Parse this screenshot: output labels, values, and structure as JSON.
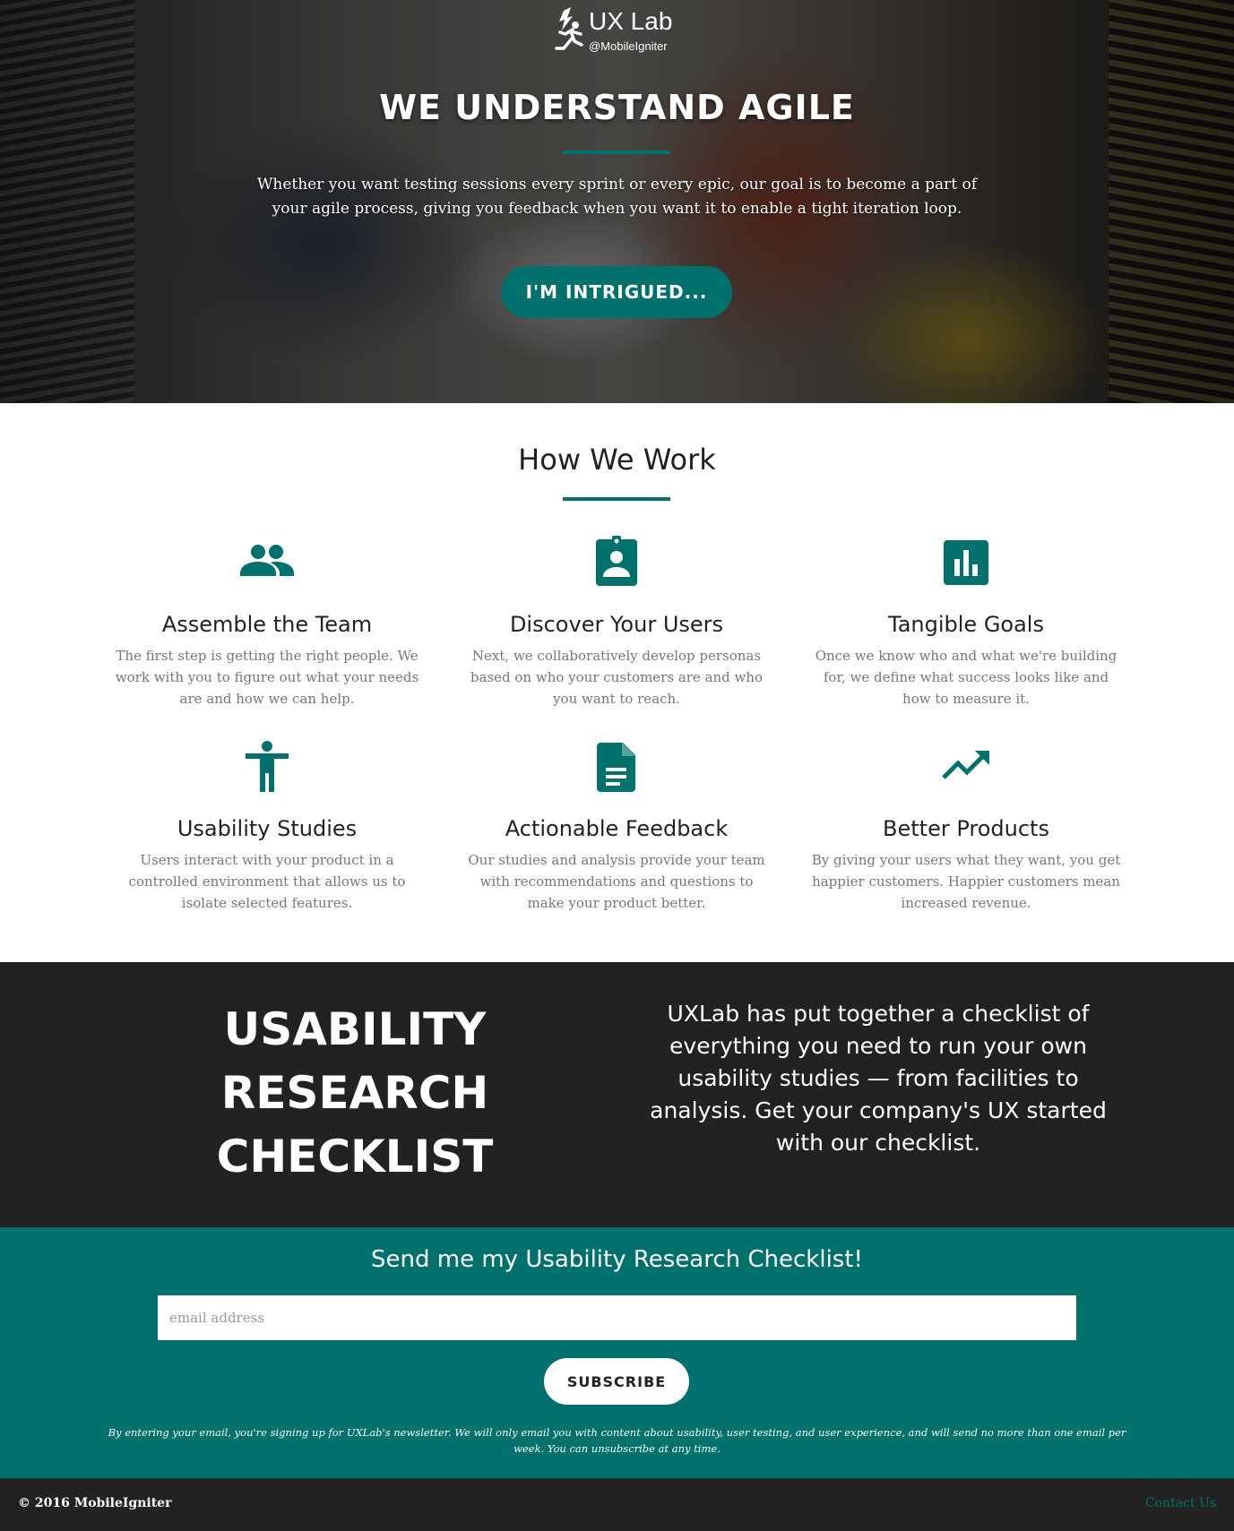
{
  "logo": {
    "name": "UX Lab",
    "handle": "@MobileIgniter"
  },
  "hero": {
    "title": "WE UNDERSTAND AGILE",
    "text": "Whether you want testing sessions every sprint or every epic, our goal is to become a part of your agile process, giving you feedback when you want it to enable a tight iteration loop.",
    "button": "I'M INTRIGUED..."
  },
  "how": {
    "title": "How We Work",
    "features": [
      {
        "icon": "group-icon",
        "title": "Assemble the Team",
        "desc": "The first step is getting the right people. We work with you to figure out what your needs are and how we can help."
      },
      {
        "icon": "assignment-ind-icon",
        "title": "Discover Your Users",
        "desc": "Next, we collaboratively develop personas based on who your customers are and who you want to reach."
      },
      {
        "icon": "bar-chart-icon",
        "title": "Tangible Goals",
        "desc": "Once we know who and what we're building for, we define what success looks like and how to measure it."
      },
      {
        "icon": "accessibility-icon",
        "title": "Usability Studies",
        "desc": "Users interact with your product in a controlled environment that allows us to isolate selected features."
      },
      {
        "icon": "document-icon",
        "title": "Actionable Feedback",
        "desc": "Our studies and analysis provide your team with recommendations and questions to make your product better."
      },
      {
        "icon": "trending-up-icon",
        "title": "Better Products",
        "desc": "By giving your users what they want, you get happier customers. Happier customers mean increased revenue."
      }
    ]
  },
  "checklist": {
    "heading": "USABILITY RESEARCH CHECKLIST",
    "text": "UXLab has put together a checklist of everything you need to run your own usability studies — from facilities to analysis. Get your company's UX started with our checklist."
  },
  "signup": {
    "title": "Send me my Usability Research Checklist!",
    "placeholder": "email address",
    "button": "SUBSCRIBE",
    "fine_print": "By entering your email, you're signing up for UXLab's newsletter. We will only email you with content about usability, user testing, and user experience, and will send no more than one email per week. You can unsubscribe at any time."
  },
  "footer": {
    "copyright": "© 2016 MobileIgniter",
    "contact": "Contact Us"
  },
  "colors": {
    "accent": "#00716d",
    "dark": "#222222"
  }
}
